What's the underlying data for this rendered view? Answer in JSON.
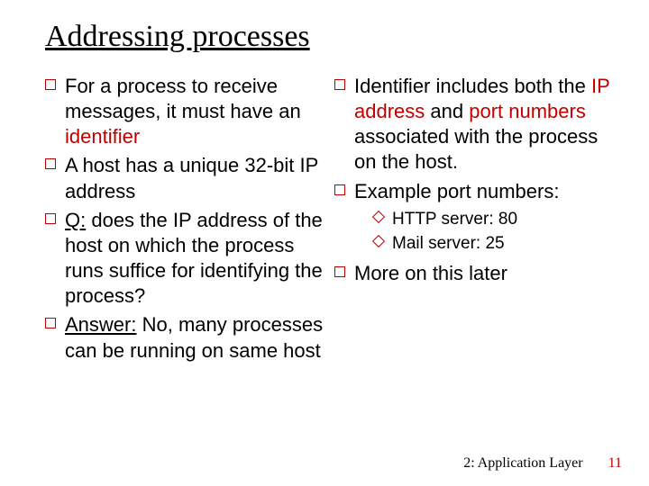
{
  "title": "Addressing processes",
  "left": {
    "b1": {
      "pre": "For a process to receive messages, it must have an ",
      "red": "identifier"
    },
    "b2": "A host has a unique  32-bit IP address",
    "b3": {
      "label": "Q:",
      "text": " does the IP address of the host on which the process runs suffice for identifying the process?"
    },
    "b4": {
      "label": "Answer:",
      "text": " No, many processes can be running on same host"
    }
  },
  "right": {
    "b1": {
      "pre": "Identifier includes both the ",
      "red1": "IP address",
      "mid": " and ",
      "red2": "port numbers",
      "post": " associated with the process on the host."
    },
    "b2": "Example port numbers:",
    "sub1": "HTTP server: 80",
    "sub2": "Mail server: 25",
    "b3": "More on this later"
  },
  "footer": {
    "chapter": "2: Application Layer",
    "page": "11"
  }
}
